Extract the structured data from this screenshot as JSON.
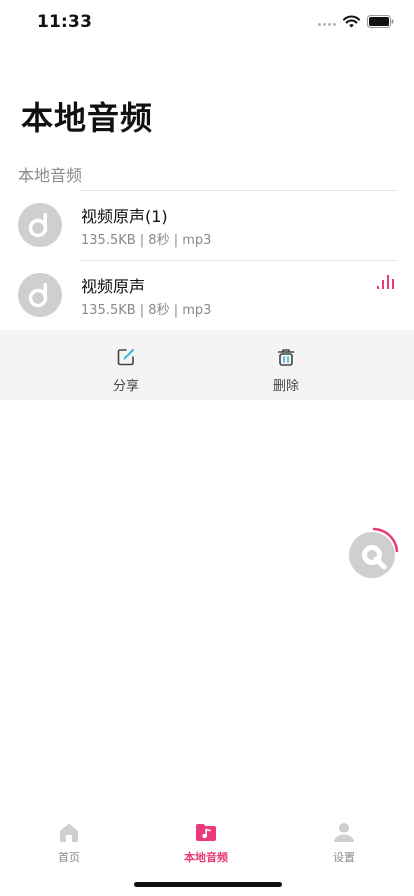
{
  "status_bar": {
    "time": "11:33"
  },
  "page": {
    "title": "本地音频"
  },
  "section": {
    "label": "本地音频"
  },
  "tracks": [
    {
      "title": "视频原声(1)",
      "meta": "135.5KB | 8秒 | mp3",
      "playing": false
    },
    {
      "title": "视频原声",
      "meta": "135.5KB | 8秒 | mp3",
      "playing": true
    }
  ],
  "actions": {
    "share_label": "分享",
    "delete_label": "删除"
  },
  "tabs": [
    {
      "label": "首页",
      "icon": "home-icon",
      "active": false
    },
    {
      "label": "本地音频",
      "icon": "music-folder-icon",
      "active": true
    },
    {
      "label": "设置",
      "icon": "user-icon",
      "active": false
    }
  ],
  "colors": {
    "accent": "#e83a7a",
    "disc_gray": "#cfcfcf",
    "action_bar_bg": "#f4f4f4",
    "share_icon_accent": "#3bb7d6"
  }
}
